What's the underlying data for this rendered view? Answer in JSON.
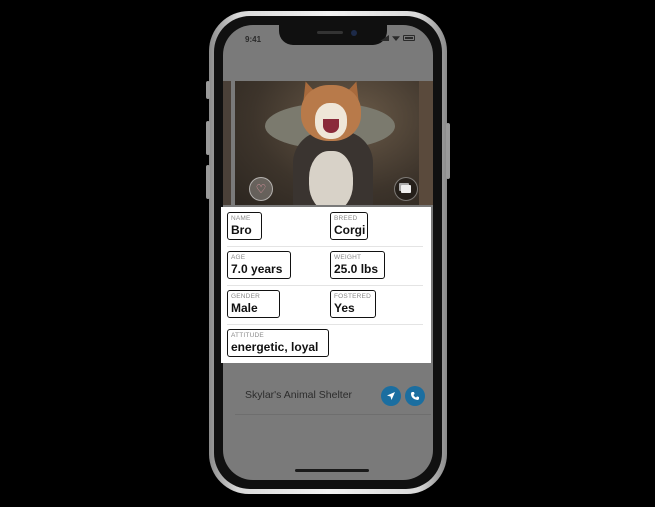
{
  "status_bar": {
    "time": "9:41"
  },
  "photo": {
    "favorite_icon": "heart-icon",
    "gallery_icon": "gallery-icon"
  },
  "details": {
    "name": {
      "label": "NAME",
      "value": "Bro"
    },
    "breed": {
      "label": "BREED",
      "value": "Corgi"
    },
    "age": {
      "label": "AGE",
      "value": "7.0 years"
    },
    "weight": {
      "label": "WEIGHT",
      "value": "25.0 lbs"
    },
    "gender": {
      "label": "GENDER",
      "value": "Male"
    },
    "fostered": {
      "label": "FOSTERED",
      "value": "Yes"
    },
    "attitude": {
      "label": "ATTITUDE",
      "value": "energetic, loyal"
    }
  },
  "shelter": {
    "name": "Skylar's Animal Shelter",
    "directions_icon": "navigation-arrow-icon",
    "call_icon": "phone-icon"
  },
  "colors": {
    "accent": "#1b6ea0",
    "dim_overlay": "#7a7a7a",
    "card": "#ffffff",
    "background": "#000000"
  }
}
